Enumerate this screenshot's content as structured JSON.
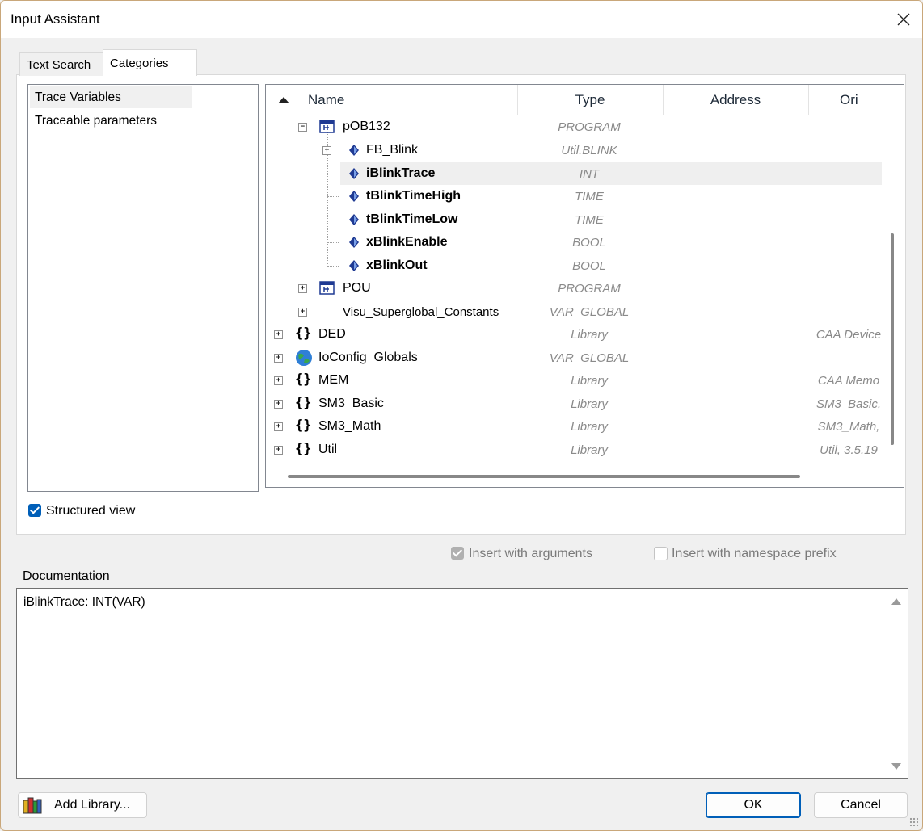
{
  "window": {
    "title": "Input Assistant"
  },
  "tabs": [
    {
      "label": "Text Search"
    },
    {
      "label": "Categories"
    }
  ],
  "categories": [
    {
      "label": "Trace Variables",
      "selected": true
    },
    {
      "label": "Traceable parameters",
      "selected": false
    }
  ],
  "tree": {
    "columns": {
      "name": "Name",
      "type": "Type",
      "address": "Address",
      "origin": "Ori"
    },
    "rows": [
      {
        "name": "pOB132",
        "type": "PROGRAM",
        "origin": "",
        "icon": "program-icon",
        "expander": "minus"
      },
      {
        "name": "FB_Blink",
        "type": "Util.BLINK",
        "origin": "",
        "icon": "variable-icon",
        "expander": "plus"
      },
      {
        "name": "iBlinkTrace",
        "type": "INT",
        "origin": "",
        "icon": "variable-icon",
        "bold": true,
        "selected": true
      },
      {
        "name": "tBlinkTimeHigh",
        "type": "TIME",
        "origin": "",
        "icon": "variable-icon",
        "bold": true
      },
      {
        "name": "tBlinkTimeLow",
        "type": "TIME",
        "origin": "",
        "icon": "variable-icon",
        "bold": true
      },
      {
        "name": "xBlinkEnable",
        "type": "BOOL",
        "origin": "",
        "icon": "variable-icon",
        "bold": true
      },
      {
        "name": "xBlinkOut",
        "type": "BOOL",
        "origin": "",
        "icon": "variable-icon",
        "bold": true
      },
      {
        "name": "POU",
        "type": "PROGRAM",
        "origin": "",
        "icon": "program-icon",
        "expander": "plus"
      },
      {
        "name": "Visu_Superglobal_Constants",
        "type": "VAR_GLOBAL",
        "origin": "",
        "icon": "",
        "expander": "plus"
      },
      {
        "name": "DED",
        "type": "Library",
        "origin": "CAA Device",
        "icon": "library-icon",
        "expander": "plus"
      },
      {
        "name": "IoConfig_Globals",
        "type": "VAR_GLOBAL",
        "origin": "",
        "icon": "globe-icon",
        "expander": "plus"
      },
      {
        "name": "MEM",
        "type": "Library",
        "origin": "CAA Memo",
        "icon": "library-icon",
        "expander": "plus"
      },
      {
        "name": "SM3_Basic",
        "type": "Library",
        "origin": "SM3_Basic,",
        "icon": "library-icon",
        "expander": "plus"
      },
      {
        "name": "SM3_Math",
        "type": "Library",
        "origin": "SM3_Math,",
        "icon": "library-icon",
        "expander": "plus"
      },
      {
        "name": "Util",
        "type": "Library",
        "origin": "Util, 3.5.19",
        "icon": "library-icon",
        "expander": "plus"
      }
    ]
  },
  "options": {
    "structured_view": {
      "label": "Structured view",
      "checked": true
    },
    "insert_with_arguments": {
      "label": "Insert with arguments",
      "checked": true,
      "disabled": true
    },
    "insert_with_namespace": {
      "label": "Insert with namespace prefix",
      "checked": false
    }
  },
  "documentation": {
    "label": "Documentation",
    "text": "iBlinkTrace: INT(VAR)"
  },
  "buttons": {
    "add_library": "Add Library...",
    "ok": "OK",
    "cancel": "Cancel"
  },
  "colors": {
    "accent": "#005fb8",
    "icon_blue": "#1f3a93",
    "type_text": "#8a8a8a"
  }
}
